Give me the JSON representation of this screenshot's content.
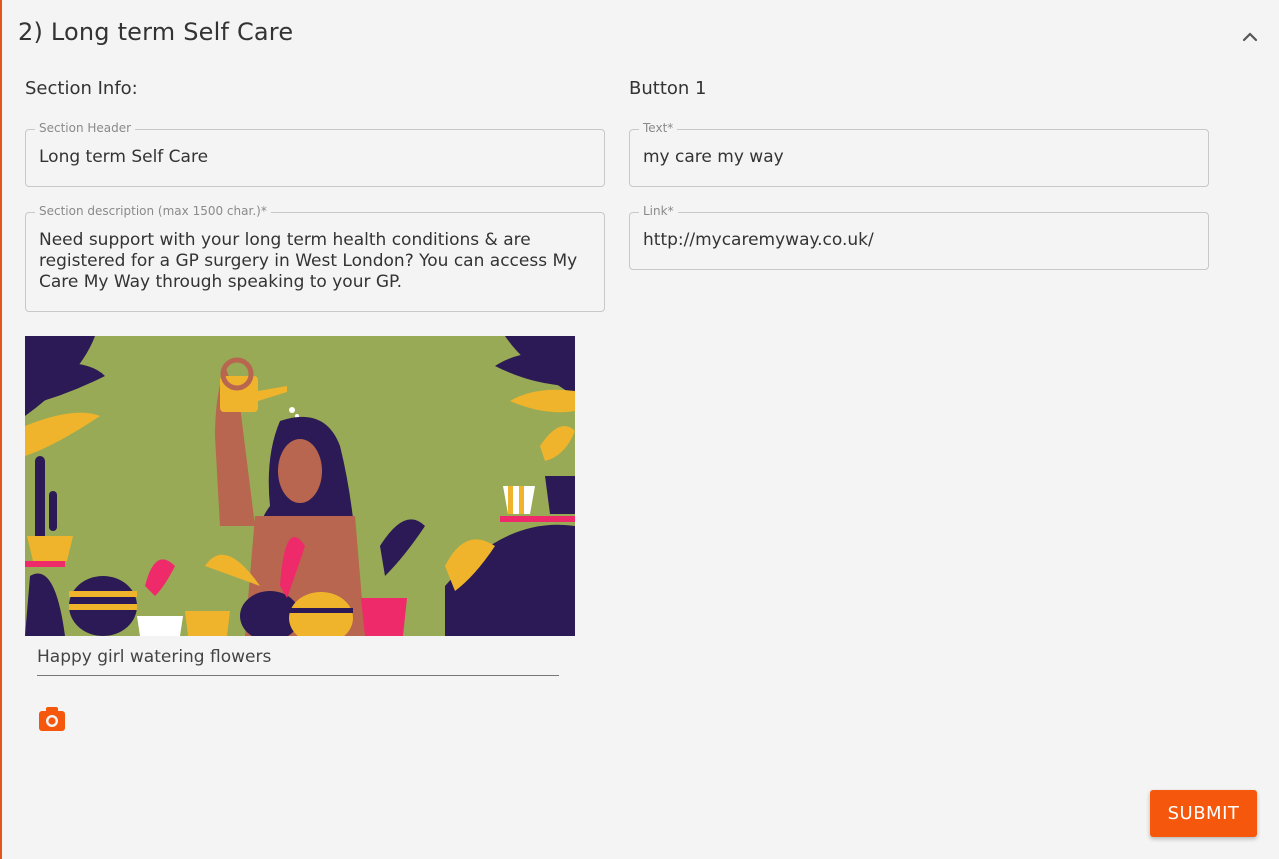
{
  "panel": {
    "title": "2) Long term Self Care"
  },
  "section_info": {
    "heading": "Section Info:",
    "header_label": "Section Header",
    "header_value": "Long term Self Care",
    "description_label": "Section description (max 1500 char.)*",
    "description_value": "Need support with your long term health conditions & are registered for a GP surgery in West London? You can access My Care My Way through speaking to your GP.",
    "image_caption": "Happy girl watering flowers"
  },
  "button1": {
    "heading": "Button 1",
    "text_label": "Text*",
    "text_value": "my care my way",
    "link_label": "Link*",
    "link_value": "http://mycaremyway.co.uk/"
  },
  "actions": {
    "submit_label": "SUBMIT"
  },
  "icons": {
    "collapse": "chevron-up-icon",
    "camera": "camera-icon"
  },
  "colors": {
    "accent": "#f5580c",
    "image_background": "#98aa55",
    "text": "#333333"
  }
}
